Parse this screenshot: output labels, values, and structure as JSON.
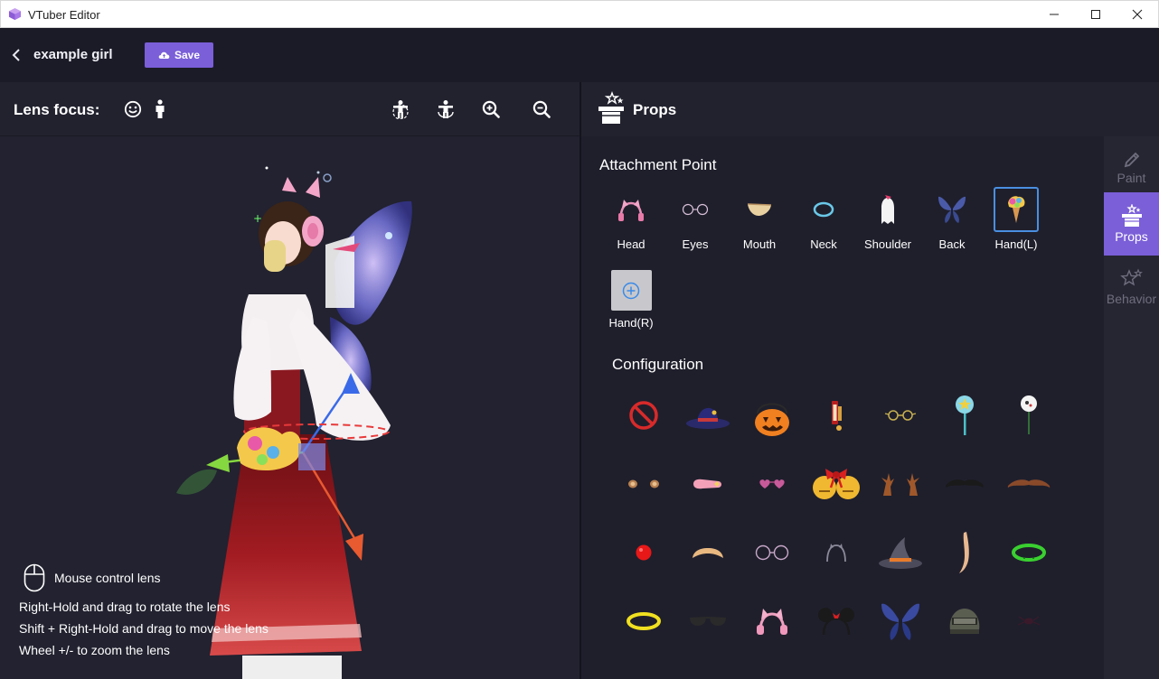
{
  "window": {
    "title": "VTuber Editor",
    "icon": "app-cube-icon",
    "controls": [
      "minimize-icon",
      "maximize-icon",
      "close-icon"
    ]
  },
  "toolbar": {
    "model_name": "example girl",
    "save_label": "Save",
    "save_color": "#7a5fd8"
  },
  "lens": {
    "label": "Lens focus:",
    "buttons": [
      "face-focus-icon",
      "body-focus-icon",
      "pose-front-icon",
      "pose-back-icon",
      "zoom-in-icon",
      "zoom-out-icon"
    ]
  },
  "hints": {
    "title": "Mouse control lens",
    "lines": [
      "Right-Hold and drag to rotate the lens",
      "Shift + Right-Hold and drag to move the lens",
      "Wheel +/- to zoom the lens"
    ]
  },
  "props": {
    "title": "Props",
    "attachment_title": "Attachment Point",
    "attachment_points": [
      {
        "label": "Head",
        "icon": "cat-ears-icon"
      },
      {
        "label": "Eyes",
        "icon": "glasses-icon"
      },
      {
        "label": "Mouth",
        "icon": "mouth-mask-icon"
      },
      {
        "label": "Neck",
        "icon": "necklace-icon"
      },
      {
        "label": "Shoulder",
        "icon": "ghost-icon"
      },
      {
        "label": "Back",
        "icon": "wings-icon"
      },
      {
        "label": "Hand(L)",
        "icon": "icecream-icon",
        "selected": true
      },
      {
        "label": "Hand(R)",
        "icon": "add-icon"
      }
    ],
    "configuration_title": "Configuration",
    "configuration_items": [
      "none-icon",
      "witch-hat-icon",
      "pumpkin-basket-icon",
      "lantern-icon",
      "round-glasses-icon",
      "magic-wand-icon",
      "lollipop-icon",
      "small-ears-icon",
      "hairclip-icon",
      "heart-glasses-icon",
      "bells-bow-icon",
      "reindeer-antlers-icon",
      "mustache-black-icon",
      "mustache-brown-icon",
      "clown-nose-icon",
      "eyebrow-band-icon",
      "round-specs-icon",
      "headband-icon",
      "wizard-hat-icon",
      "tail-icon",
      "green-collar-icon",
      "yellow-collar-icon",
      "sunglasses-icon",
      "pink-cat-ears-icon",
      "mouse-ears-icon",
      "butterfly-wings-icon",
      "helmet-icon",
      "spider-icon"
    ]
  },
  "side_tabs": [
    {
      "label": "Paint",
      "icon": "brush-icon",
      "active": false
    },
    {
      "label": "Props",
      "icon": "magic-hat-icon",
      "active": true
    },
    {
      "label": "Behavior",
      "icon": "stars-icon",
      "active": false
    }
  ]
}
